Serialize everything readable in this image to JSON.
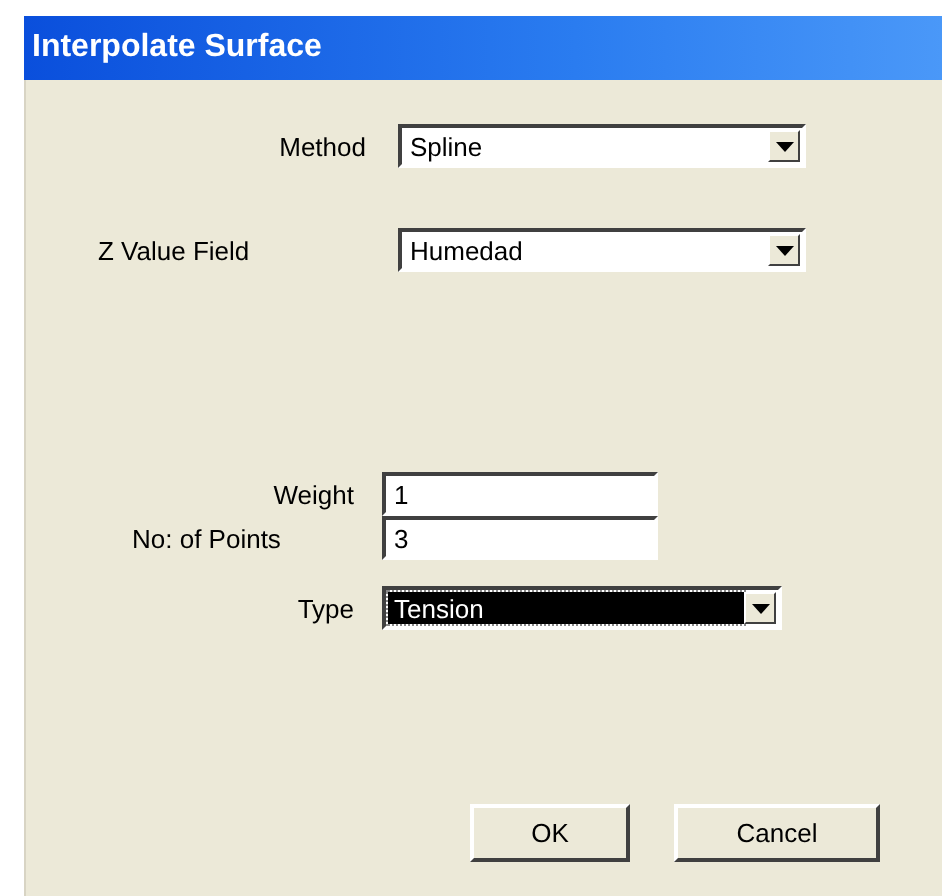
{
  "window": {
    "title": "Interpolate Surface"
  },
  "fields": [
    {
      "label": "Method",
      "kind": "dropdown",
      "value": "Spline",
      "focused": false
    },
    {
      "label": "Z Value Field",
      "kind": "dropdown",
      "value": "Humedad",
      "focused": false
    },
    {
      "label": "Weight",
      "kind": "text",
      "value": "1",
      "focused": false
    },
    {
      "label": "No: of Points",
      "kind": "text",
      "value": "3",
      "focused": false
    },
    {
      "label": "Type",
      "kind": "dropdown",
      "value": "Tension",
      "focused": true
    }
  ],
  "buttons": [
    "OK",
    "Cancel"
  ]
}
